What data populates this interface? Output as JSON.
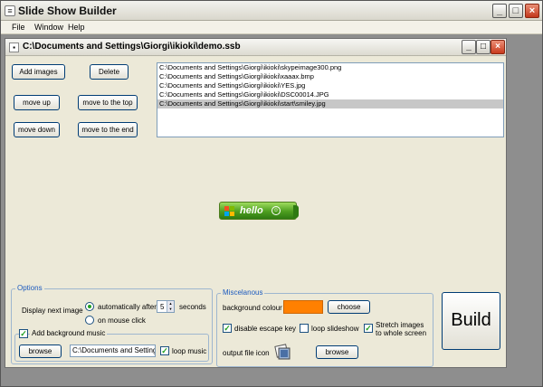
{
  "app": {
    "title": "Slide Show Builder"
  },
  "menu": [
    "File",
    "Window",
    "Help"
  ],
  "child": {
    "title": "C:\\Documents and Settings\\Giorgi\\ikioki\\demo.ssb"
  },
  "buttons": {
    "add_images": "Add images",
    "delete": "Delete",
    "move_up": "move up",
    "move_to_top": "move to the top",
    "move_down": "move down",
    "move_to_end": "move to the end"
  },
  "files": [
    "C:\\Documents and Settings\\Giorgi\\ikioki\\skypeimage300.png",
    "C:\\Documents and Settings\\Giorgi\\ikioki\\xaaax.bmp",
    "C:\\Documents and Settings\\Giorgi\\ikioki\\YES.jpg",
    "C:\\Documents and Settings\\Giorgi\\ikioki\\DSC00014.JPG",
    "C:\\Documents and Settings\\Giorgi\\ikioki\\start\\smiley.jpg"
  ],
  "selected_file_index": 4,
  "preview": {
    "text": "hello",
    "smiley": "☺"
  },
  "options": {
    "legend": "Options",
    "display_next_label": "Display next image",
    "auto_label": "automatically after",
    "seconds_value": "5",
    "seconds_label": "seconds",
    "mouse_label": "on mouse click",
    "auto_selected": true,
    "music_legend": "Add background music",
    "music_checked": true,
    "browse_label": "browse",
    "music_path": "C:\\Documents and Settings",
    "loop_music_label": "loop music",
    "loop_music_checked": true
  },
  "misc": {
    "legend": "Miscelanous",
    "bg_colour_label": "background colour",
    "bg_colour": "#ff8000",
    "choose_label": "choose",
    "disable_escape_label": "disable escape key",
    "disable_escape_checked": true,
    "loop_slideshow_label": "loop slideshow",
    "loop_slideshow_checked": false,
    "stretch_label_1": "Stretch images",
    "stretch_label_2": "to whole screen",
    "stretch_checked": true,
    "output_icon_label": "output file icon",
    "browse_label": "browse"
  },
  "build_label": "Build"
}
